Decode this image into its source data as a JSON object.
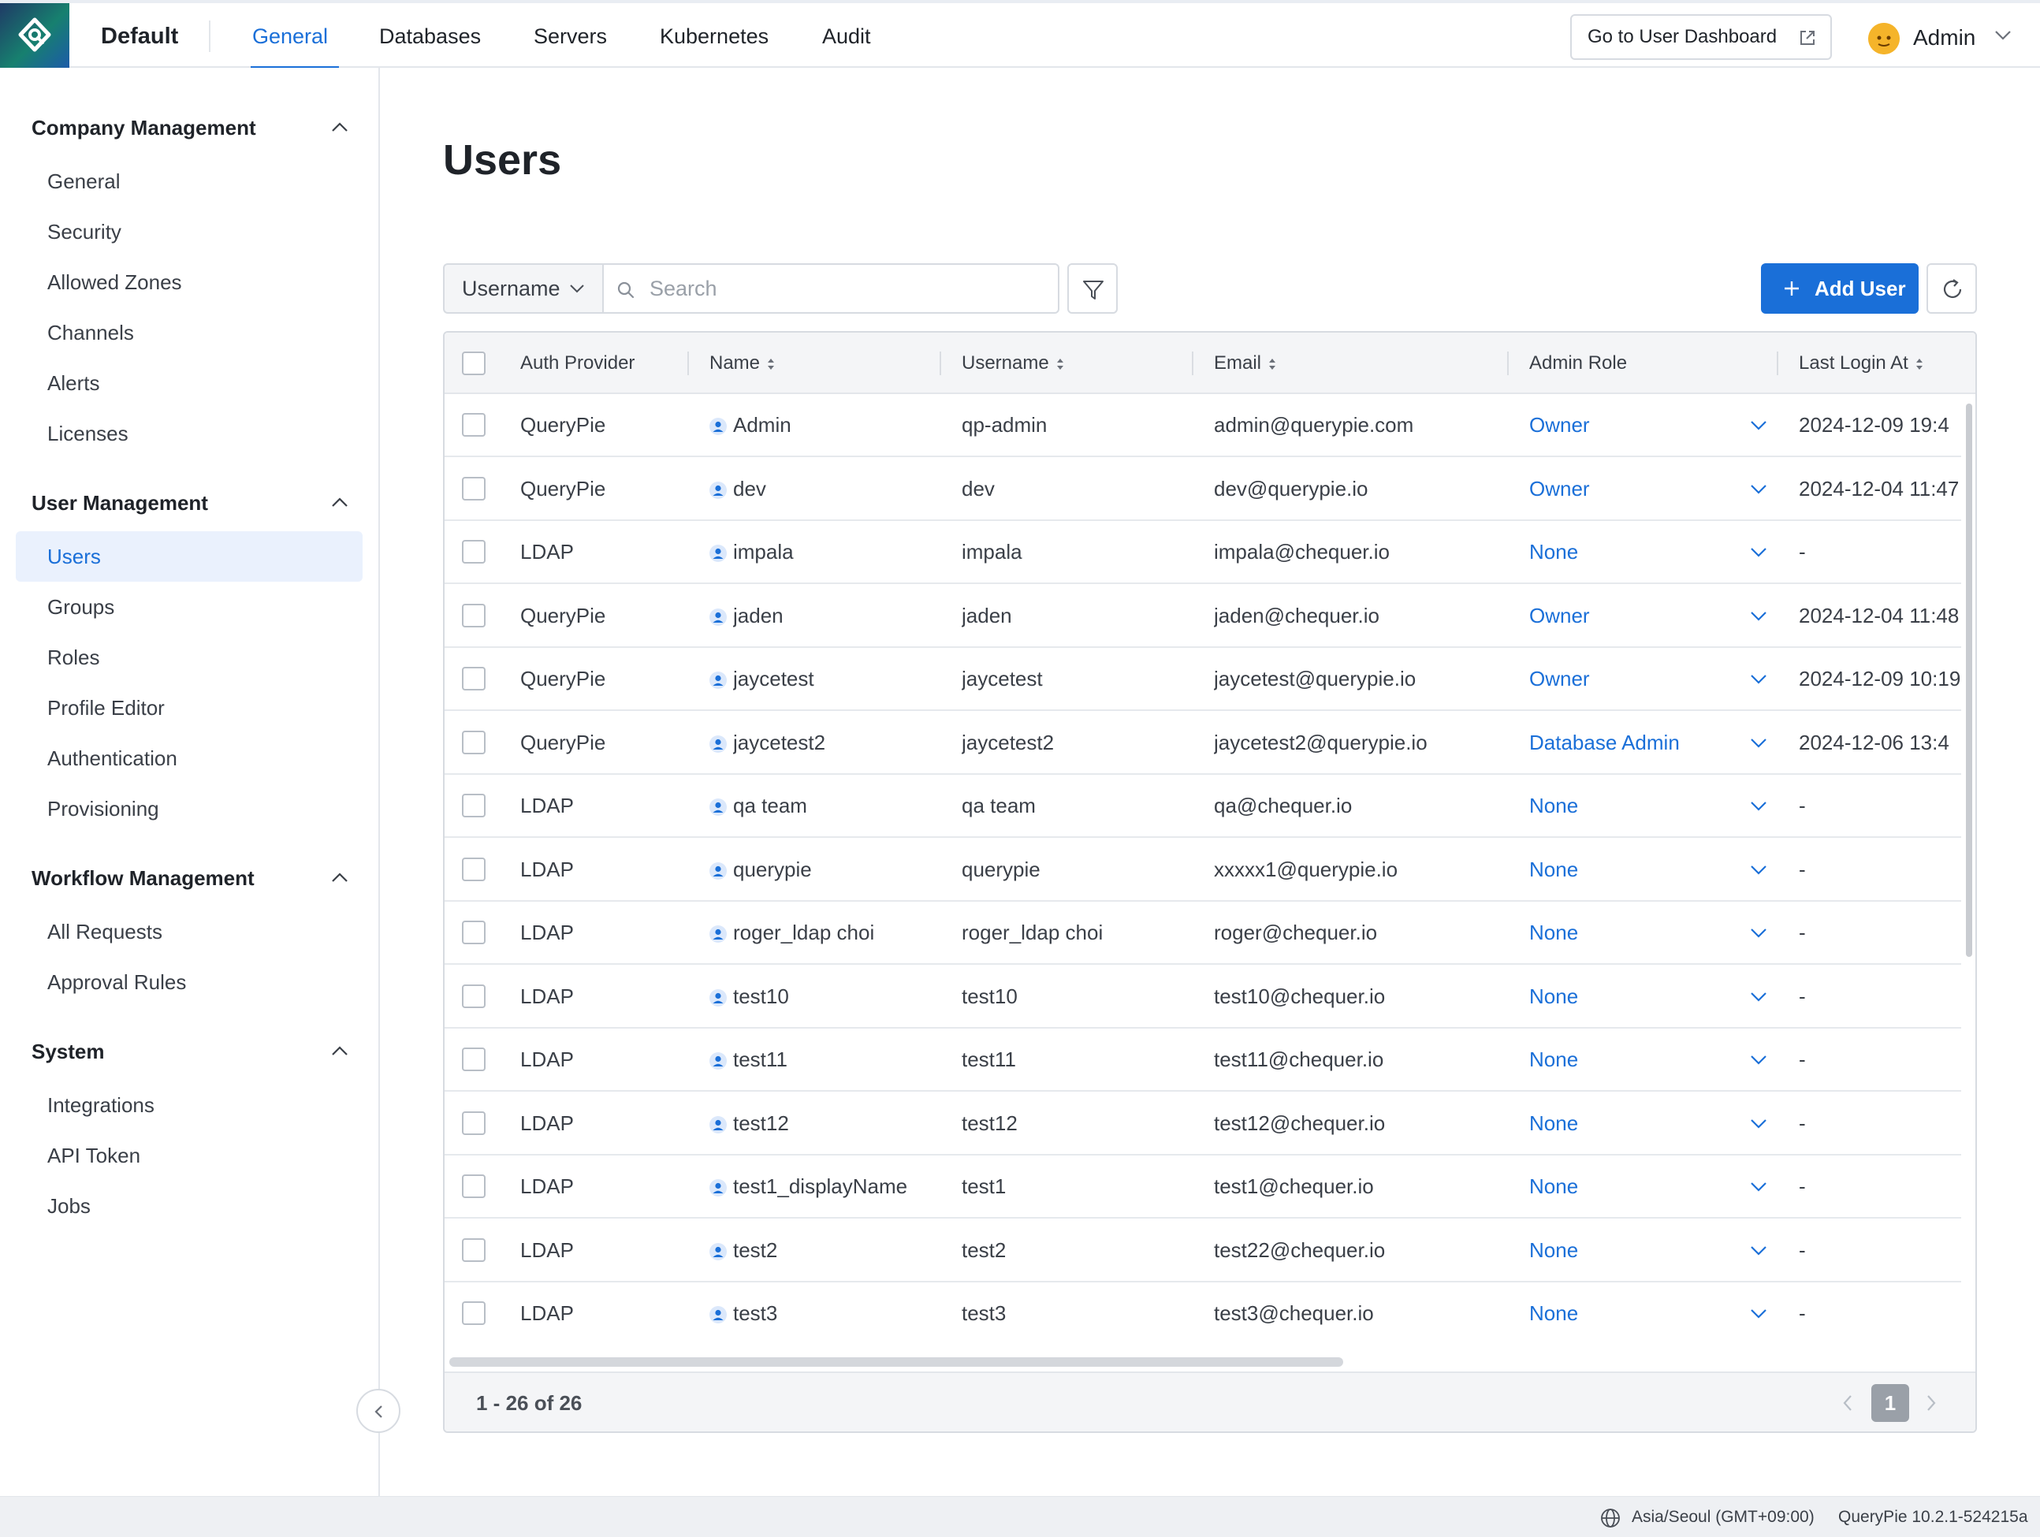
{
  "header": {
    "workspace": "Default",
    "tabs": [
      {
        "label": "General",
        "active": true
      },
      {
        "label": "Databases",
        "active": false
      },
      {
        "label": "Servers",
        "active": false
      },
      {
        "label": "Kubernetes",
        "active": false
      },
      {
        "label": "Audit",
        "active": false
      }
    ],
    "dashboard_button": "Go to User Dashboard",
    "user_name": "Admin"
  },
  "sidebar": {
    "sections": [
      {
        "title": "Company Management",
        "items": [
          "General",
          "Security",
          "Allowed Zones",
          "Channels",
          "Alerts",
          "Licenses"
        ]
      },
      {
        "title": "User Management",
        "items": [
          "Users",
          "Groups",
          "Roles",
          "Profile Editor",
          "Authentication",
          "Provisioning"
        ]
      },
      {
        "title": "Workflow Management",
        "items": [
          "All Requests",
          "Approval Rules"
        ]
      },
      {
        "title": "System",
        "items": [
          "Integrations",
          "API Token",
          "Jobs"
        ]
      }
    ],
    "active_item": "Users"
  },
  "main": {
    "title": "Users",
    "search_field": "Username",
    "search_placeholder": "Search",
    "add_button": "Add User",
    "columns": [
      "Auth Provider",
      "Name",
      "Username",
      "Email",
      "Admin Role",
      "Last Login At"
    ],
    "rows": [
      {
        "provider": "QueryPie",
        "name": "Admin",
        "username": "qp-admin",
        "email": "admin@querypie.com",
        "role": "Owner",
        "last_login": "2024-12-09 19:4"
      },
      {
        "provider": "QueryPie",
        "name": "dev",
        "username": "dev",
        "email": "dev@querypie.io",
        "role": "Owner",
        "last_login": "2024-12-04 11:47"
      },
      {
        "provider": "LDAP",
        "name": "impala",
        "username": "impala",
        "email": "impala@chequer.io",
        "role": "None",
        "last_login": "-"
      },
      {
        "provider": "QueryPie",
        "name": "jaden",
        "username": "jaden",
        "email": "jaden@chequer.io",
        "role": "Owner",
        "last_login": "2024-12-04 11:48"
      },
      {
        "provider": "QueryPie",
        "name": "jaycetest",
        "username": "jaycetest",
        "email": "jaycetest@querypie.io",
        "role": "Owner",
        "last_login": "2024-12-09 10:19"
      },
      {
        "provider": "QueryPie",
        "name": "jaycetest2",
        "username": "jaycetest2",
        "email": "jaycetest2@querypie.io",
        "role": "Database Admin",
        "last_login": "2024-12-06 13:4"
      },
      {
        "provider": "LDAP",
        "name": "qa team",
        "username": "qa team",
        "email": "qa@chequer.io",
        "role": "None",
        "last_login": "-"
      },
      {
        "provider": "LDAP",
        "name": "querypie",
        "username": "querypie",
        "email": "xxxxx1@querypie.io",
        "role": "None",
        "last_login": "-"
      },
      {
        "provider": "LDAP",
        "name": "roger_ldap choi",
        "username": "roger_ldap choi",
        "email": "roger@chequer.io",
        "role": "None",
        "last_login": "-"
      },
      {
        "provider": "LDAP",
        "name": "test10",
        "username": "test10",
        "email": "test10@chequer.io",
        "role": "None",
        "last_login": "-"
      },
      {
        "provider": "LDAP",
        "name": "test11",
        "username": "test11",
        "email": "test11@chequer.io",
        "role": "None",
        "last_login": "-"
      },
      {
        "provider": "LDAP",
        "name": "test12",
        "username": "test12",
        "email": "test12@chequer.io",
        "role": "None",
        "last_login": "-"
      },
      {
        "provider": "LDAP",
        "name": "test1_displayName",
        "username": "test1",
        "email": "test1@chequer.io",
        "role": "None",
        "last_login": "-"
      },
      {
        "provider": "LDAP",
        "name": "test2",
        "username": "test2",
        "email": "test22@chequer.io",
        "role": "None",
        "last_login": "-"
      },
      {
        "provider": "LDAP",
        "name": "test3",
        "username": "test3",
        "email": "test3@chequer.io",
        "role": "None",
        "last_login": "-"
      }
    ],
    "pagination": {
      "summary": "1 - 26 of 26",
      "current_page": "1"
    }
  },
  "status_bar": {
    "timezone": "Asia/Seoul (GMT+09:00)",
    "version": "QueryPie 10.2.1-524215a"
  },
  "colors": {
    "accent": "#1a6fd8",
    "brand_logo": "#17806f"
  }
}
